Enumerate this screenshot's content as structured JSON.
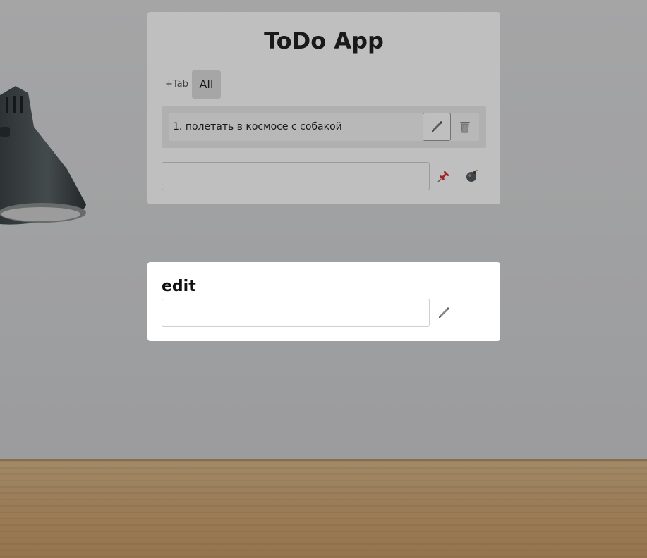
{
  "app": {
    "title": "ToDo App"
  },
  "tabs": {
    "add_label": "+Tab",
    "items": [
      {
        "label": "All",
        "selected": true
      }
    ]
  },
  "todos": [
    {
      "number": "1.",
      "text": "полетать в космосе с собакой"
    }
  ],
  "new_todo": {
    "value": "",
    "placeholder": "",
    "pin_icon": "pushpin-icon",
    "clear_icon": "bomb-icon"
  },
  "edit_modal": {
    "title": "edit",
    "value": "",
    "placeholder": "",
    "confirm_icon": "pencil-icon"
  },
  "colors": {
    "overlay": "rgba(0,0,0,0.25)",
    "card": "#ffffff",
    "tab_selected": "#dedede",
    "list_bg": "#ebebeb",
    "pin_red": "#d9303a"
  }
}
